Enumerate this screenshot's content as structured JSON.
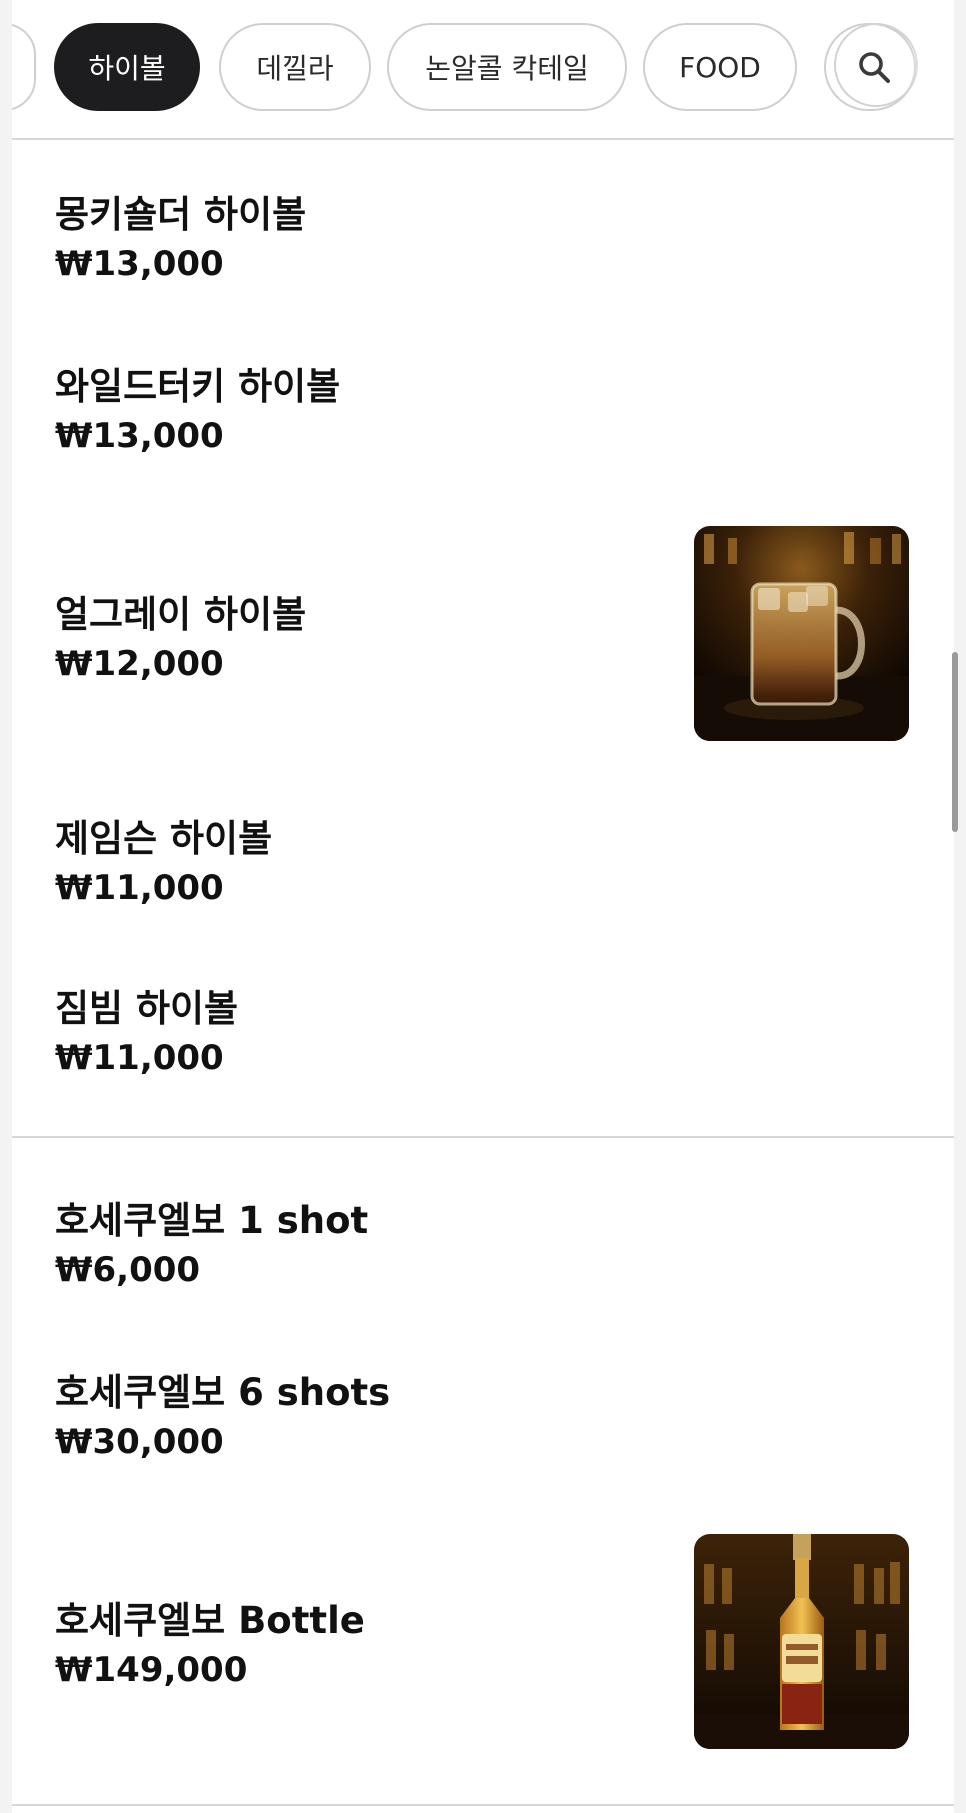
{
  "categories": {
    "tabs": [
      {
        "label": "하이볼",
        "active": true
      },
      {
        "label": "데낄라",
        "active": false
      },
      {
        "label": "논알콜 칵테일",
        "active": false
      },
      {
        "label": "FOOD",
        "active": false
      }
    ],
    "search_icon": "search-icon"
  },
  "highball_section": {
    "items": [
      {
        "name": "몽키숄더 하이볼",
        "price": "₩13,000"
      },
      {
        "name": "와일드터키 하이볼",
        "price": "₩13,000"
      },
      {
        "name": "얼그레이 하이볼",
        "price": "₩12,000",
        "image": "highball-mug-photo"
      },
      {
        "name": "제임슨 하이볼",
        "price": "₩11,000"
      },
      {
        "name": "짐빔 하이볼",
        "price": "₩11,000"
      }
    ]
  },
  "tequila_section": {
    "items": [
      {
        "name": "호세쿠엘보 1 shot",
        "price": "₩6,000"
      },
      {
        "name": "호세쿠엘보 6 shots",
        "price": "₩30,000"
      },
      {
        "name": "호세쿠엘보 Bottle",
        "price": "₩149,000",
        "image": "tequila-bottle-photo"
      }
    ]
  },
  "colors": {
    "active_chip_bg": "#1d1d1f",
    "chip_border": "#cfcfcf",
    "divider": "#d6d6d6",
    "text": "#111111"
  }
}
